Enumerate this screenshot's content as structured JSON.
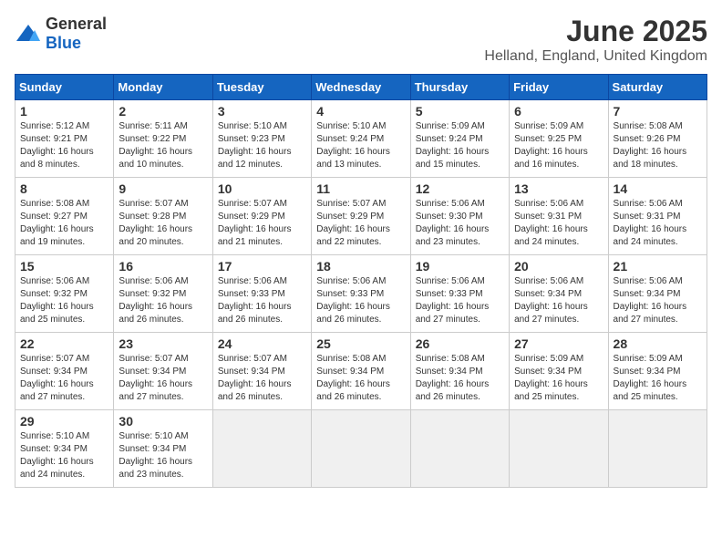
{
  "header": {
    "logo_general": "General",
    "logo_blue": "Blue",
    "month": "June 2025",
    "location": "Helland, England, United Kingdom"
  },
  "days_of_week": [
    "Sunday",
    "Monday",
    "Tuesday",
    "Wednesday",
    "Thursday",
    "Friday",
    "Saturday"
  ],
  "weeks": [
    [
      {
        "day": "1",
        "sunrise": "Sunrise: 5:12 AM",
        "sunset": "Sunset: 9:21 PM",
        "daylight": "Daylight: 16 hours and 8 minutes."
      },
      {
        "day": "2",
        "sunrise": "Sunrise: 5:11 AM",
        "sunset": "Sunset: 9:22 PM",
        "daylight": "Daylight: 16 hours and 10 minutes."
      },
      {
        "day": "3",
        "sunrise": "Sunrise: 5:10 AM",
        "sunset": "Sunset: 9:23 PM",
        "daylight": "Daylight: 16 hours and 12 minutes."
      },
      {
        "day": "4",
        "sunrise": "Sunrise: 5:10 AM",
        "sunset": "Sunset: 9:24 PM",
        "daylight": "Daylight: 16 hours and 13 minutes."
      },
      {
        "day": "5",
        "sunrise": "Sunrise: 5:09 AM",
        "sunset": "Sunset: 9:24 PM",
        "daylight": "Daylight: 16 hours and 15 minutes."
      },
      {
        "day": "6",
        "sunrise": "Sunrise: 5:09 AM",
        "sunset": "Sunset: 9:25 PM",
        "daylight": "Daylight: 16 hours and 16 minutes."
      },
      {
        "day": "7",
        "sunrise": "Sunrise: 5:08 AM",
        "sunset": "Sunset: 9:26 PM",
        "daylight": "Daylight: 16 hours and 18 minutes."
      }
    ],
    [
      {
        "day": "8",
        "sunrise": "Sunrise: 5:08 AM",
        "sunset": "Sunset: 9:27 PM",
        "daylight": "Daylight: 16 hours and 19 minutes."
      },
      {
        "day": "9",
        "sunrise": "Sunrise: 5:07 AM",
        "sunset": "Sunset: 9:28 PM",
        "daylight": "Daylight: 16 hours and 20 minutes."
      },
      {
        "day": "10",
        "sunrise": "Sunrise: 5:07 AM",
        "sunset": "Sunset: 9:29 PM",
        "daylight": "Daylight: 16 hours and 21 minutes."
      },
      {
        "day": "11",
        "sunrise": "Sunrise: 5:07 AM",
        "sunset": "Sunset: 9:29 PM",
        "daylight": "Daylight: 16 hours and 22 minutes."
      },
      {
        "day": "12",
        "sunrise": "Sunrise: 5:06 AM",
        "sunset": "Sunset: 9:30 PM",
        "daylight": "Daylight: 16 hours and 23 minutes."
      },
      {
        "day": "13",
        "sunrise": "Sunrise: 5:06 AM",
        "sunset": "Sunset: 9:31 PM",
        "daylight": "Daylight: 16 hours and 24 minutes."
      },
      {
        "day": "14",
        "sunrise": "Sunrise: 5:06 AM",
        "sunset": "Sunset: 9:31 PM",
        "daylight": "Daylight: 16 hours and 24 minutes."
      }
    ],
    [
      {
        "day": "15",
        "sunrise": "Sunrise: 5:06 AM",
        "sunset": "Sunset: 9:32 PM",
        "daylight": "Daylight: 16 hours and 25 minutes."
      },
      {
        "day": "16",
        "sunrise": "Sunrise: 5:06 AM",
        "sunset": "Sunset: 9:32 PM",
        "daylight": "Daylight: 16 hours and 26 minutes."
      },
      {
        "day": "17",
        "sunrise": "Sunrise: 5:06 AM",
        "sunset": "Sunset: 9:33 PM",
        "daylight": "Daylight: 16 hours and 26 minutes."
      },
      {
        "day": "18",
        "sunrise": "Sunrise: 5:06 AM",
        "sunset": "Sunset: 9:33 PM",
        "daylight": "Daylight: 16 hours and 26 minutes."
      },
      {
        "day": "19",
        "sunrise": "Sunrise: 5:06 AM",
        "sunset": "Sunset: 9:33 PM",
        "daylight": "Daylight: 16 hours and 27 minutes."
      },
      {
        "day": "20",
        "sunrise": "Sunrise: 5:06 AM",
        "sunset": "Sunset: 9:34 PM",
        "daylight": "Daylight: 16 hours and 27 minutes."
      },
      {
        "day": "21",
        "sunrise": "Sunrise: 5:06 AM",
        "sunset": "Sunset: 9:34 PM",
        "daylight": "Daylight: 16 hours and 27 minutes."
      }
    ],
    [
      {
        "day": "22",
        "sunrise": "Sunrise: 5:07 AM",
        "sunset": "Sunset: 9:34 PM",
        "daylight": "Daylight: 16 hours and 27 minutes."
      },
      {
        "day": "23",
        "sunrise": "Sunrise: 5:07 AM",
        "sunset": "Sunset: 9:34 PM",
        "daylight": "Daylight: 16 hours and 27 minutes."
      },
      {
        "day": "24",
        "sunrise": "Sunrise: 5:07 AM",
        "sunset": "Sunset: 9:34 PM",
        "daylight": "Daylight: 16 hours and 26 minutes."
      },
      {
        "day": "25",
        "sunrise": "Sunrise: 5:08 AM",
        "sunset": "Sunset: 9:34 PM",
        "daylight": "Daylight: 16 hours and 26 minutes."
      },
      {
        "day": "26",
        "sunrise": "Sunrise: 5:08 AM",
        "sunset": "Sunset: 9:34 PM",
        "daylight": "Daylight: 16 hours and 26 minutes."
      },
      {
        "day": "27",
        "sunrise": "Sunrise: 5:09 AM",
        "sunset": "Sunset: 9:34 PM",
        "daylight": "Daylight: 16 hours and 25 minutes."
      },
      {
        "day": "28",
        "sunrise": "Sunrise: 5:09 AM",
        "sunset": "Sunset: 9:34 PM",
        "daylight": "Daylight: 16 hours and 25 minutes."
      }
    ],
    [
      {
        "day": "29",
        "sunrise": "Sunrise: 5:10 AM",
        "sunset": "Sunset: 9:34 PM",
        "daylight": "Daylight: 16 hours and 24 minutes."
      },
      {
        "day": "30",
        "sunrise": "Sunrise: 5:10 AM",
        "sunset": "Sunset: 9:34 PM",
        "daylight": "Daylight: 16 hours and 23 minutes."
      },
      null,
      null,
      null,
      null,
      null
    ]
  ]
}
